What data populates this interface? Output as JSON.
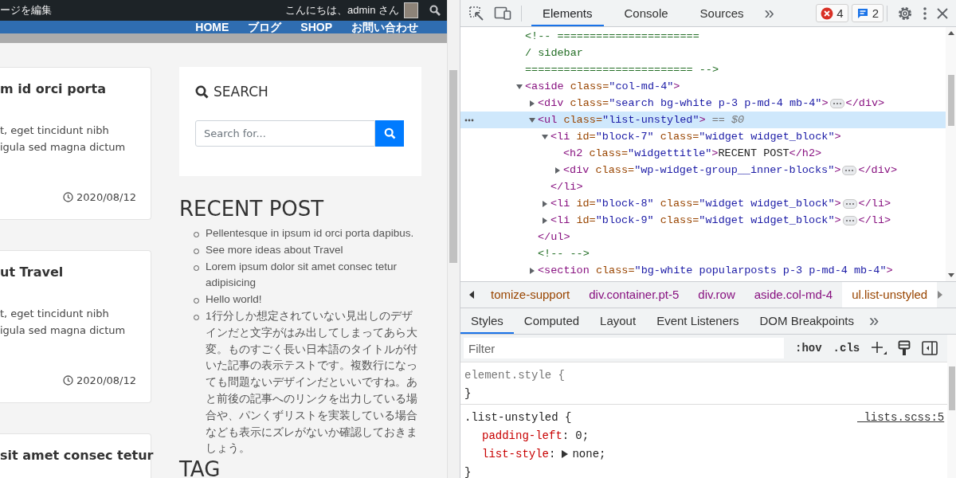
{
  "admin_bar": {
    "edit_label": "ージを編集",
    "greeting": "こんにちは、admin さん"
  },
  "nav": {
    "items": [
      "HOME",
      "ブログ",
      "SHOP",
      "お問い合わせ"
    ]
  },
  "posts": [
    {
      "title": "m id orci porta",
      "excerpt_lines": [
        "t, eget tincidunt nibh",
        "igula sed magna dictum"
      ],
      "date": "2020/08/12"
    },
    {
      "title": "ut Travel",
      "excerpt_lines": [
        "t, eget tincidunt nibh",
        "igula sed magna dictum"
      ],
      "date": "2020/08/12"
    },
    {
      "title": "sit amet consec tetur"
    }
  ],
  "sidebar": {
    "search": {
      "heading": "SEARCH",
      "placeholder": "Search for..."
    },
    "recent_post": {
      "heading": "RECENT POST",
      "items": [
        "Pellentesque in ipsum id orci porta dapibus.",
        "See more ideas about Travel",
        "Lorem ipsum dolor sit amet consec tetur adipisicing",
        "Hello world!",
        "1行分しか想定されていない見出しのデザインだと文字がはみ出してしまってあら大変。ものすごく長い日本語のタイトルが付いた記事の表示テストです。複数行になっても問題ないデザインだといいですね。あと前後の記事へのリンクを出力している場合や、パンくずリストを実装している場合なども表示にズレがないか確認しておきましょう。"
      ]
    },
    "tag": {
      "heading": "TAG"
    }
  },
  "devtools": {
    "tabs": [
      {
        "label": "Elements",
        "selected": true
      },
      {
        "label": "Console",
        "selected": false
      },
      {
        "label": "Sources",
        "selected": false
      }
    ],
    "more_tabs": "»",
    "errors": "4",
    "messages": "2",
    "dom_tree": [
      {
        "kind": "comment",
        "lines": [
          "<!-- ======================",
          "/  sidebar",
          "========================== -->"
        ]
      },
      {
        "kind": "element",
        "expanded": true,
        "selected": false,
        "open": [
          {
            "kind": "tag",
            "text": "<aside"
          },
          {
            "kind": "attr",
            "text": " class="
          },
          {
            "kind": "value",
            "text": "\"col-md-4\""
          },
          {
            "kind": "tag",
            "text": ">"
          }
        ],
        "children": [
          {
            "kind": "element",
            "expanded": false,
            "selected": false,
            "open": [
              {
                "kind": "tag",
                "text": "<div"
              },
              {
                "kind": "attr",
                "text": " class="
              },
              {
                "kind": "value",
                "text": "\"search bg-white p-3 p-md-4 mb-4\""
              },
              {
                "kind": "tag",
                "text": ">"
              }
            ],
            "close": [
              {
                "kind": "tag",
                "text": "</div>"
              }
            ]
          },
          {
            "kind": "element",
            "expanded": true,
            "selected": true,
            "console_ref": "== $0",
            "open": [
              {
                "kind": "tag",
                "text": "<ul"
              },
              {
                "kind": "attr",
                "text": " class="
              },
              {
                "kind": "value",
                "text": "\"list-unstyled\""
              },
              {
                "kind": "tag",
                "text": ">"
              }
            ],
            "children": [
              {
                "kind": "element",
                "expanded": true,
                "selected": false,
                "open": [
                  {
                    "kind": "tag",
                    "text": "<li"
                  },
                  {
                    "kind": "attr",
                    "text": " id="
                  },
                  {
                    "kind": "value",
                    "text": "\"block-7\""
                  },
                  {
                    "kind": "attr",
                    "text": " class="
                  },
                  {
                    "kind": "value",
                    "text": "\"widget widget_block\""
                  },
                  {
                    "kind": "tag",
                    "text": ">"
                  }
                ],
                "children": [
                  {
                    "kind": "leaf",
                    "tokens": [
                      {
                        "kind": "tag",
                        "text": "<h2"
                      },
                      {
                        "kind": "attr",
                        "text": " class="
                      },
                      {
                        "kind": "value",
                        "text": "\"widgettitle\""
                      },
                      {
                        "kind": "tag",
                        "text": ">"
                      },
                      {
                        "kind": "text",
                        "text": "RECENT POST"
                      },
                      {
                        "kind": "tag",
                        "text": "</h2>"
                      }
                    ]
                  },
                  {
                    "kind": "element",
                    "expanded": false,
                    "selected": false,
                    "open": [
                      {
                        "kind": "tag",
                        "text": "<div"
                      },
                      {
                        "kind": "attr",
                        "text": " class="
                      },
                      {
                        "kind": "value",
                        "text": "\"wp-widget-group__inner-blocks\""
                      },
                      {
                        "kind": "tag",
                        "text": ">"
                      }
                    ],
                    "close": [
                      {
                        "kind": "tag",
                        "text": "</div>"
                      }
                    ]
                  }
                ],
                "close": [
                  {
                    "kind": "tag",
                    "text": "</li>"
                  }
                ]
              },
              {
                "kind": "element",
                "expanded": false,
                "selected": false,
                "open": [
                  {
                    "kind": "tag",
                    "text": "<li"
                  },
                  {
                    "kind": "attr",
                    "text": " id="
                  },
                  {
                    "kind": "value",
                    "text": "\"block-8\""
                  },
                  {
                    "kind": "attr",
                    "text": " class="
                  },
                  {
                    "kind": "value",
                    "text": "\"widget widget_block\""
                  },
                  {
                    "kind": "tag",
                    "text": ">"
                  }
                ],
                "close": [
                  {
                    "kind": "tag",
                    "text": "</li>"
                  }
                ]
              },
              {
                "kind": "element",
                "expanded": false,
                "selected": false,
                "open": [
                  {
                    "kind": "tag",
                    "text": "<li"
                  },
                  {
                    "kind": "attr",
                    "text": " id="
                  },
                  {
                    "kind": "value",
                    "text": "\"block-9\""
                  },
                  {
                    "kind": "attr",
                    "text": " class="
                  },
                  {
                    "kind": "value",
                    "text": "\"widget widget_block\""
                  },
                  {
                    "kind": "tag",
                    "text": ">"
                  }
                ],
                "close": [
                  {
                    "kind": "tag",
                    "text": "</li>"
                  }
                ]
              }
            ],
            "close": [
              {
                "kind": "tag",
                "text": "</ul>"
              }
            ]
          },
          {
            "kind": "comment",
            "lines": [
              "<!-- -->"
            ]
          },
          {
            "kind": "element",
            "expanded": false,
            "selected": false,
            "open": [
              {
                "kind": "tag",
                "text": "<section"
              },
              {
                "kind": "attr",
                "text": " class="
              },
              {
                "kind": "value",
                "text": "\"bg-white popularposts p-3 p-md-4 mb-4\""
              },
              {
                "kind": "tag",
                "text": ">"
              }
            ]
          }
        ]
      }
    ],
    "breadcrumbs": [
      {
        "selected": false,
        "parts": [
          {
            "kind": "class",
            "text": "tomize-support"
          }
        ]
      },
      {
        "selected": false,
        "parts": [
          {
            "kind": "tag",
            "text": "div"
          },
          {
            "kind": "class",
            "text": ".container.pt-5"
          }
        ]
      },
      {
        "selected": false,
        "parts": [
          {
            "kind": "tag",
            "text": "div"
          },
          {
            "kind": "class",
            "text": ".row"
          }
        ]
      },
      {
        "selected": false,
        "parts": [
          {
            "kind": "tag",
            "text": "aside"
          },
          {
            "kind": "class",
            "text": ".col-md-4"
          }
        ]
      },
      {
        "selected": true,
        "parts": [
          {
            "kind": "tag",
            "text": "ul"
          },
          {
            "kind": "class",
            "text": ".list-unstyled"
          }
        ]
      }
    ],
    "pane_tabs": [
      {
        "label": "Styles",
        "selected": true
      },
      {
        "label": "Computed",
        "selected": false
      },
      {
        "label": "Layout",
        "selected": false
      },
      {
        "label": "Event Listeners",
        "selected": false
      },
      {
        "label": "DOM Breakpoints",
        "selected": false
      }
    ],
    "pane_more": "»",
    "filter": {
      "placeholder": "Filter",
      "hov": ":hov",
      "cls": ".cls"
    },
    "rules": [
      {
        "kind": "inline",
        "selector": "element.style {",
        "close": "}"
      },
      {
        "kind": "stylesheet",
        "selector": ".list-unstyled {",
        "source": "_lists.scss:5",
        "close": "}",
        "props": [
          {
            "name": "padding-left",
            "colon": ":",
            "value": "0;",
            "expandable": false
          },
          {
            "name": "list-style",
            "colon": ":",
            "value": "none;",
            "expandable": true
          }
        ]
      }
    ]
  }
}
